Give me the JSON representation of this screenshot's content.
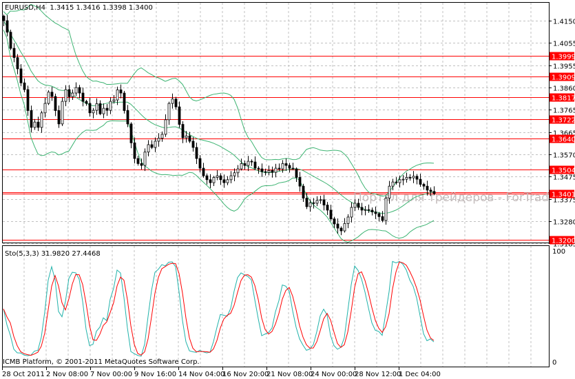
{
  "window": {
    "symbol_header": "EURUSD,H4  1.3415 1.3416 1.3398 1.3400",
    "indicator_header": "Sto(5,3,3) 31.9820 27.4468",
    "copyright": "ICMB Platform, © 2001-2011 MetaQuotes Software Corp.",
    "watermark": "Портал для трейдеров - ForTrader.ru"
  },
  "colors": {
    "candle": "#000000",
    "bollinger": "#3cb371",
    "level_line": "#ff0000",
    "stoch_main": "#20b2aa",
    "stoch_signal": "#ff0000",
    "grid": "#c0c0c0"
  },
  "chart_data": {
    "type": "candlestick",
    "symbol": "EURUSD",
    "timeframe": "H4",
    "price_ticks": [
      "1.4150",
      "1.4055",
      "1.3955",
      "1.3860",
      "1.3765",
      "1.3665",
      "1.3570",
      "1.3475",
      "1.3375",
      "1.3280",
      "1.3185"
    ],
    "ylim": [
      1.3185,
      1.415
    ],
    "time_labels": [
      "28 Oct 2011",
      "2 Nov 08:00",
      "7 Nov 00:00",
      "9 Nov 16:00",
      "14 Nov 04:00",
      "16 Nov 20:00",
      "21 Nov 08:00",
      "24 Nov 00:00",
      "28 Nov 12:00",
      "1 Dec 04:00"
    ],
    "closes": [
      1.415,
      1.41,
      1.403,
      1.399,
      1.3941,
      1.388,
      1.3851,
      1.376,
      1.3687,
      1.371,
      1.3687,
      1.375,
      1.3791,
      1.384,
      1.3821,
      1.376,
      1.3702,
      1.38,
      1.3851,
      1.382,
      1.3836,
      1.386,
      1.3836,
      1.38,
      1.3791,
      1.375,
      1.3761,
      1.379,
      1.3746,
      1.377,
      1.3761,
      1.38,
      1.3806,
      1.385,
      1.3836,
      1.376,
      1.3702,
      1.362,
      1.3552,
      1.353,
      1.3522,
      1.358,
      1.3612,
      1.36,
      1.3627,
      1.364,
      1.3657,
      1.372,
      1.3791,
      1.381,
      1.3776,
      1.37,
      1.3642,
      1.365,
      1.3627,
      1.36,
      1.3552,
      1.351,
      1.3477,
      1.346,
      1.3447,
      1.347,
      1.3477,
      1.346,
      1.3447,
      1.346,
      1.3477,
      1.349,
      1.3507,
      1.353,
      1.3522,
      1.354,
      1.3537,
      1.351,
      1.3507,
      1.3495,
      1.3492,
      1.35,
      1.3492,
      1.351,
      1.3507,
      1.353,
      1.3522,
      1.351,
      1.3507,
      1.347,
      1.3432,
      1.338,
      1.3343,
      1.336,
      1.3358,
      1.337,
      1.3373,
      1.335,
      1.3328,
      1.329,
      1.3268,
      1.325,
      1.3238,
      1.327,
      1.3298,
      1.334,
      1.3358,
      1.334,
      1.3328,
      1.333,
      1.3328,
      1.332,
      1.3313,
      1.33,
      1.3283,
      1.338,
      1.3432,
      1.345,
      1.3447,
      1.346,
      1.3462,
      1.347,
      1.3468,
      1.3475,
      1.3462,
      1.344,
      1.3432,
      1.3415,
      1.3409,
      1.34
    ],
    "indicators": [
      "Bollinger Bands",
      "Stochastic(5,3,3)"
    ],
    "horizontal_levels": [
      {
        "value": 1.3999,
        "label": "1.3999"
      },
      {
        "value": 1.3909,
        "label": "1.3909"
      },
      {
        "value": 1.3817,
        "label": "1.3817"
      },
      {
        "value": 1.3722,
        "label": "1.3722"
      },
      {
        "value": 1.364,
        "label": "1.3640"
      },
      {
        "value": 1.3504,
        "label": "1.3504"
      },
      {
        "value": 1.3405,
        "label": ""
      },
      {
        "value": 1.3401,
        "label": "1.3401"
      },
      {
        "value": 1.32,
        "label": "1.3200"
      }
    ],
    "stoch_scale": [
      "100",
      "0"
    ],
    "grid": true
  }
}
